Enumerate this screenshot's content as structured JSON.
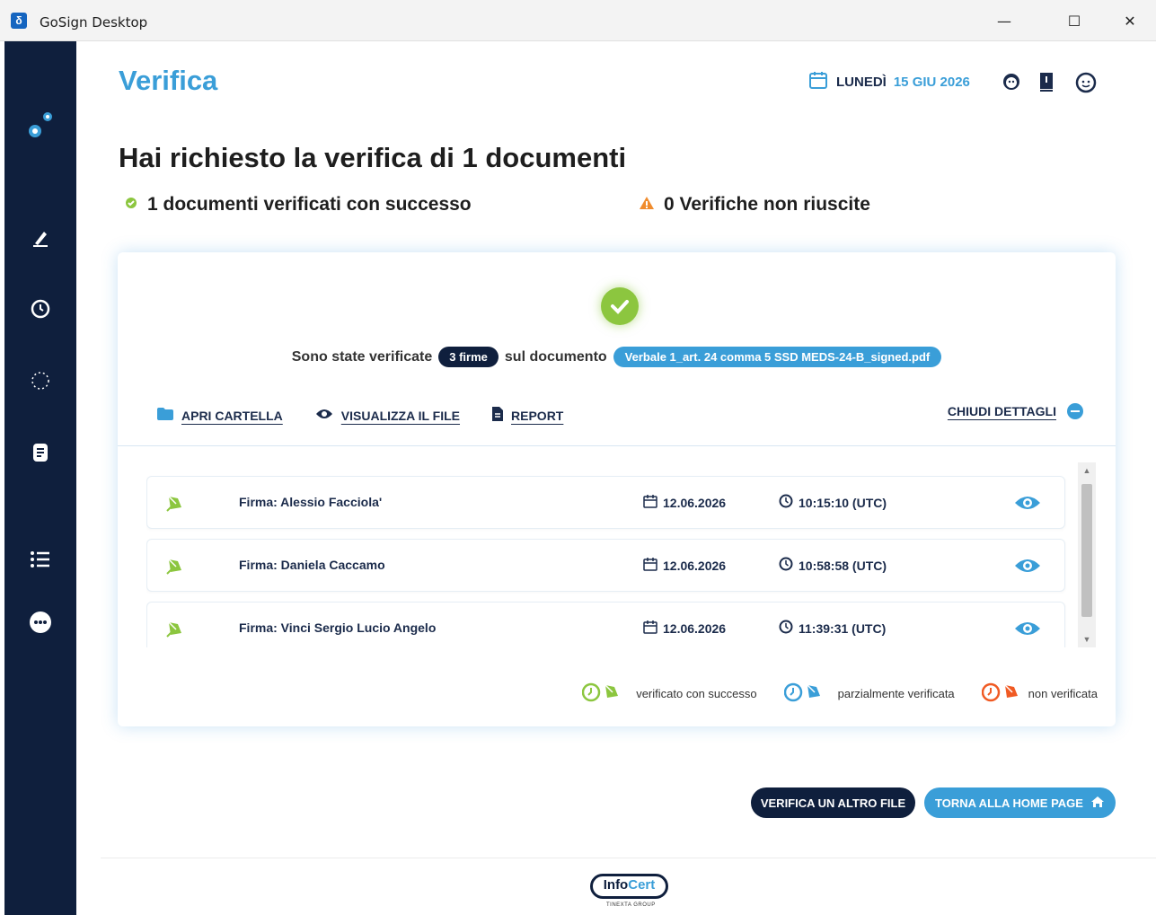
{
  "window": {
    "title": "GoSign Desktop",
    "app_icon_glyph": "δ",
    "minimize": "—",
    "maximize": "☐",
    "close": "✕"
  },
  "header": {
    "title": "Verifica",
    "weekday": "LUNEDÌ",
    "date": "15 GIU 2026"
  },
  "summary": {
    "heading": "Hai richiesto la verifica di 1 documenti",
    "success": "1 documenti verificati con successo",
    "failed": "0 Verifiche non riuscite"
  },
  "card": {
    "verified_prefix": "Sono state verificate",
    "signatures_badge": "3 firme",
    "verified_middle": "sul documento",
    "document_name": "Verbale 1_art. 24 comma 5 SSD MEDS-24-B_signed.pdf",
    "actions": {
      "open_folder": "APRI CARTELLA",
      "view_file": "VISUALIZZA IL FILE",
      "report": "REPORT",
      "close_details": "CHIUDI DETTAGLI"
    },
    "signatures": [
      {
        "name": "Firma: Alessio Facciola'",
        "date": "12.06.2026",
        "time": "10:15:10 (UTC)"
      },
      {
        "name": "Firma: Daniela Caccamo",
        "date": "12.06.2026",
        "time": "10:58:58 (UTC)"
      },
      {
        "name": "Firma: Vinci Sergio Lucio Angelo",
        "date": "12.06.2026",
        "time": "11:39:31 (UTC)"
      }
    ],
    "legend": {
      "success": "verificato con successo",
      "partial": "parzialmente verificata",
      "failed": "non verificata"
    }
  },
  "buttons": {
    "verify_another": "VERIFICA UN ALTRO FILE",
    "home": "TORNA ALLA HOME PAGE"
  },
  "footer": {
    "logo_info": "Info",
    "logo_cert": "Cert",
    "logo_sub": "TINEXTA GROUP"
  },
  "colors": {
    "accent": "#3a9ed8",
    "navy": "#0f1f3d",
    "success": "#8cc63f",
    "warning": "#f08c2e",
    "partial": "#3a9ed8",
    "error": "#f05a23"
  }
}
